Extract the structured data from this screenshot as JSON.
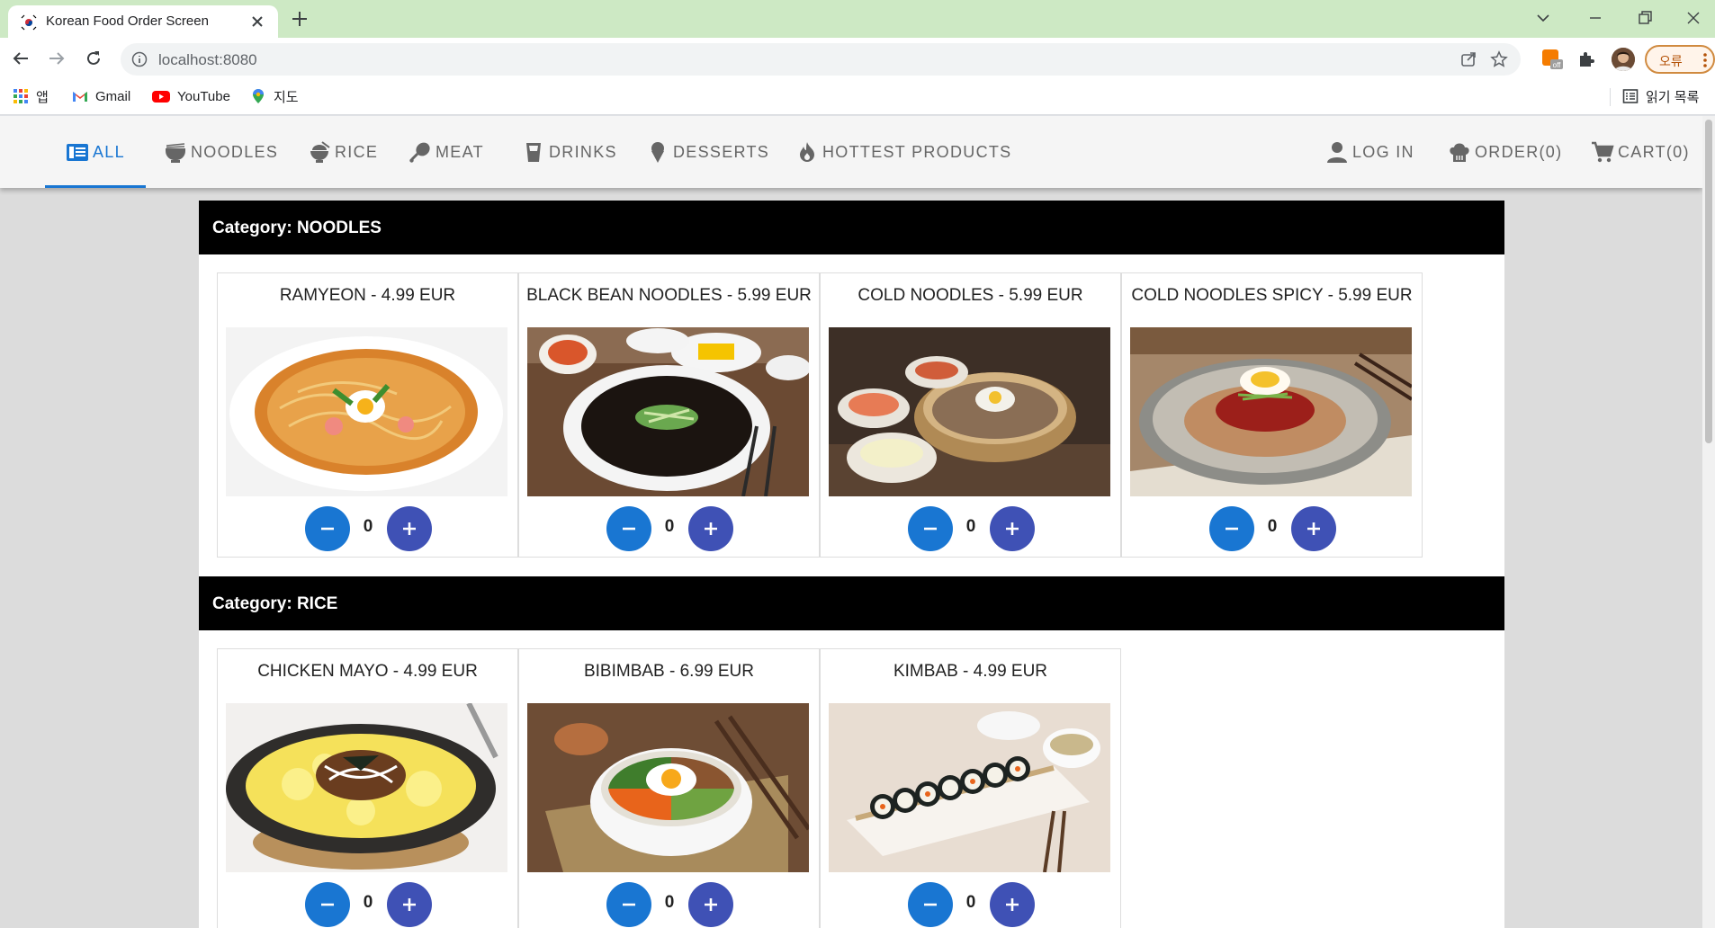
{
  "browser": {
    "tab_title": "Korean Food Order Screen",
    "url": "localhost:8080",
    "error_chip": "오류",
    "bookmarks": [
      {
        "label": "앱",
        "icon": "apps-grid-icon"
      },
      {
        "label": "Gmail",
        "icon": "gmail-icon"
      },
      {
        "label": "YouTube",
        "icon": "youtube-icon"
      },
      {
        "label": "지도",
        "icon": "maps-pin-icon"
      }
    ],
    "reading_list": "읽기 목록"
  },
  "nav": {
    "items": [
      {
        "label": "ALL",
        "icon": "list-icon",
        "active": true
      },
      {
        "label": "NOODLES",
        "icon": "noodle-bowl-icon"
      },
      {
        "label": "RICE",
        "icon": "rice-bowl-icon"
      },
      {
        "label": "MEAT",
        "icon": "drumstick-icon"
      },
      {
        "label": "DRINKS",
        "icon": "cup-icon"
      },
      {
        "label": "DESSERTS",
        "icon": "ice-cream-icon"
      },
      {
        "label": "HOTTEST PRODUCTS",
        "icon": "fire-icon"
      }
    ],
    "right": [
      {
        "label": "LOG IN",
        "icon": "person-icon"
      },
      {
        "label": "ORDER(0)",
        "icon": "chef-hat-icon"
      },
      {
        "label": "CART(0)",
        "icon": "cart-icon"
      }
    ],
    "accent": "#1976d2"
  },
  "categories": [
    {
      "title": "Category: NOODLES",
      "products": [
        {
          "name": "RAMYEON - 4.99 EUR",
          "qty": "0",
          "photo": "ramyeon-photo"
        },
        {
          "name": "BLACK BEAN NOODLES - 5.99 EUR",
          "qty": "0",
          "photo": "black-bean-noodles-photo"
        },
        {
          "name": "COLD NOODLES - 5.99 EUR",
          "qty": "0",
          "photo": "cold-noodles-photo"
        },
        {
          "name": "COLD NOODLES SPICY - 5.99 EUR",
          "qty": "0",
          "photo": "cold-noodles-spicy-photo"
        }
      ]
    },
    {
      "title": "Category: RICE",
      "products": [
        {
          "name": "CHICKEN MAYO - 4.99 EUR",
          "qty": "0",
          "photo": "chicken-mayo-photo"
        },
        {
          "name": "BIBIMBAB - 6.99 EUR",
          "qty": "0",
          "photo": "bibimbab-photo"
        },
        {
          "name": "KIMBAB - 4.99 EUR",
          "qty": "0",
          "photo": "kimbab-photo"
        }
      ]
    }
  ],
  "colors": {
    "minus_button": "#1976d2",
    "plus_button": "#3f51b5",
    "category_header": "#000000"
  }
}
